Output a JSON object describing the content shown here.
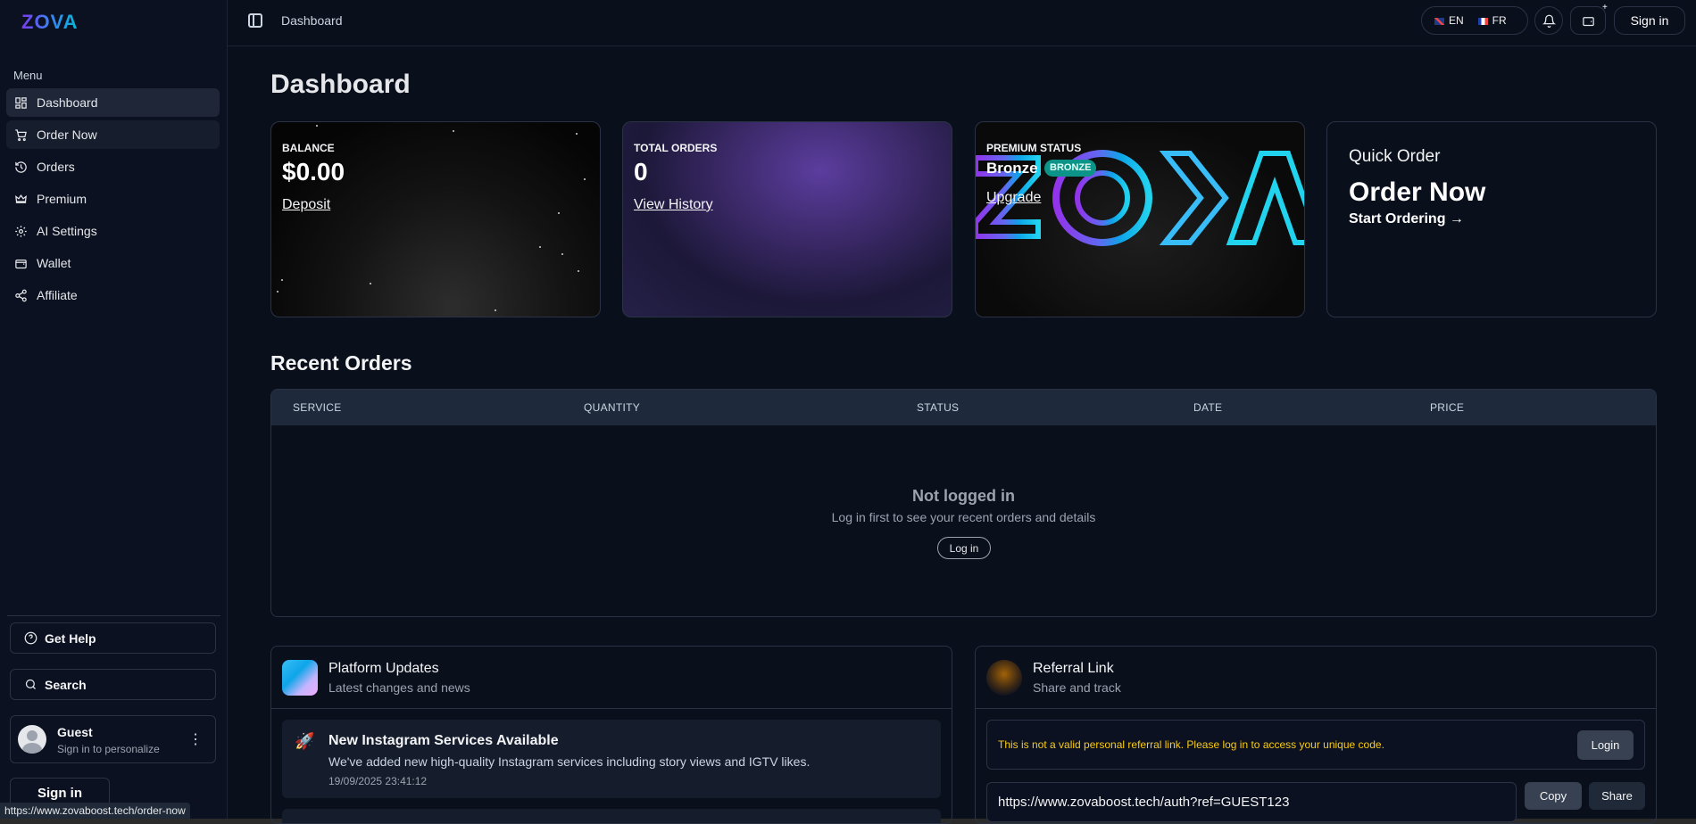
{
  "brand": {
    "logo": "ZOVA"
  },
  "sidebar": {
    "menu_title": "Menu",
    "items": [
      {
        "label": "Dashboard",
        "icon": "dashboard-icon"
      },
      {
        "label": "Order Now",
        "icon": "cart-icon"
      },
      {
        "label": "Orders",
        "icon": "history-icon"
      },
      {
        "label": "Premium",
        "icon": "crown-icon"
      },
      {
        "label": "AI Settings",
        "icon": "gear-icon"
      },
      {
        "label": "Wallet",
        "icon": "wallet-icon"
      },
      {
        "label": "Affiliate",
        "icon": "share-icon"
      }
    ],
    "help_label": "Get Help",
    "search_label": "Search",
    "user": {
      "name": "Guest",
      "subtitle": "Sign in to personalize"
    },
    "signin_label": "Sign in"
  },
  "status_url": "https://www.zovaboost.tech/order-now",
  "topbar": {
    "breadcrumb": "Dashboard",
    "lang_en": "EN",
    "lang_fr": "FR",
    "plus": "+",
    "signin_label": "Sign in"
  },
  "page": {
    "title": "Dashboard"
  },
  "cards": {
    "balance": {
      "label": "BALANCE",
      "value": "$0.00",
      "link": "Deposit"
    },
    "orders": {
      "label": "TOTAL ORDERS",
      "value": "0",
      "link": "View History"
    },
    "premium": {
      "label": "PREMIUM STATUS",
      "tier": "Bronze",
      "badge": "BRONZE",
      "link": "Upgrade",
      "art_text": "ZOVA"
    },
    "quick": {
      "label": "Quick Order",
      "title": "Order Now",
      "link": "Start Ordering →"
    }
  },
  "recent_orders": {
    "title": "Recent Orders",
    "columns": [
      "SERVICE",
      "QUANTITY",
      "STATUS",
      "DATE",
      "PRICE"
    ],
    "empty_title": "Not logged in",
    "empty_sub": "Log in first to see your recent orders and details",
    "login_label": "Log in"
  },
  "updates": {
    "title": "Platform Updates",
    "subtitle": "Latest changes and news",
    "items": [
      {
        "icon": "🚀",
        "title": "New Instagram Services Available",
        "desc": "We've added new high-quality Instagram services including story views and IGTV likes.",
        "date": "19/09/2025 23:41:12"
      }
    ]
  },
  "referral": {
    "title": "Referral Link",
    "subtitle": "Share and track",
    "warning": "This is not a valid personal referral link. Please log in to access your unique code.",
    "login_label": "Login",
    "link_value": "https://www.zovaboost.tech/auth?ref=GUEST123",
    "copy_label": "Copy",
    "share_label": "Share"
  },
  "colors": {
    "accent_teal": "#0d9488",
    "warning": "#facc15",
    "bg": "#0a0f1c"
  }
}
